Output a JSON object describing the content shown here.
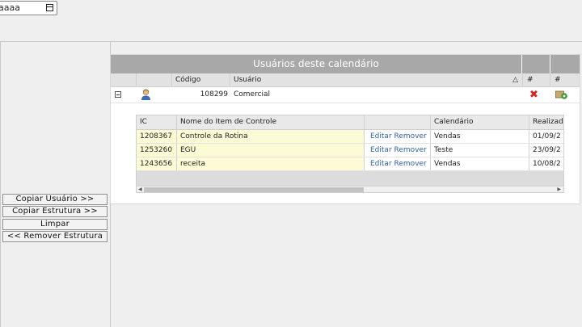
{
  "date_field": {
    "value": "aaaa",
    "icon": "calendar-icon"
  },
  "buttons": {
    "copy_user": "Copiar Usuário >>",
    "copy_structure": "Copiar Estrutura >>",
    "clear": "Limpar",
    "remove_structure": "<< Remover Estrutura"
  },
  "users_panel": {
    "title": "Usuários deste calendário",
    "columns": {
      "code": "Código",
      "user": "Usuário",
      "hash1": "#",
      "hash2": "#"
    },
    "rows": [
      {
        "code": "108299",
        "user": "Comercial"
      }
    ]
  },
  "subgrid": {
    "columns": {
      "ic": "IC",
      "name": "Nome do Item de Controle",
      "actions": "",
      "calendar": "Calendário",
      "realized": "Realizado"
    },
    "rows": [
      {
        "ic": "1208367",
        "name": "Controle da Rotina",
        "edit": "Editar",
        "remove": "Remover",
        "calendar": "Vendas",
        "date": "01/09/2"
      },
      {
        "ic": "1253260",
        "name": "EGU",
        "edit": "Editar",
        "remove": "Remover",
        "calendar": "Teste",
        "date": "23/09/2"
      },
      {
        "ic": "1243656",
        "name": "receita",
        "edit": "Editar",
        "remove": "Remover",
        "calendar": "Vendas",
        "date": "10/08/2"
      }
    ]
  },
  "colors": {
    "header_gray": "#a8a8a8",
    "link_blue": "#2f61a8",
    "row_yellow": "#fcfbd6",
    "delete_red": "#d9261c"
  }
}
